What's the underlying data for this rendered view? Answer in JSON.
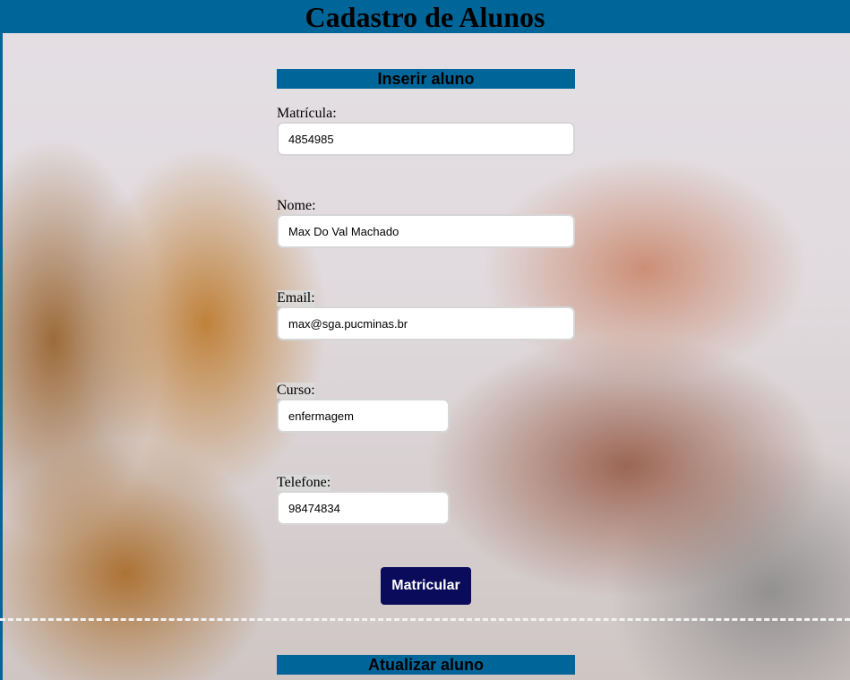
{
  "header": {
    "title": "Cadastro de Alunos"
  },
  "insert_section": {
    "heading": "Inserir aluno",
    "fields": {
      "matricula": {
        "label": "Matrícula:",
        "value": "4854985"
      },
      "nome": {
        "label": "Nome:",
        "value": "Max Do Val Machado"
      },
      "email": {
        "label": "Email:",
        "value": "max@sga.pucminas.br"
      },
      "curso": {
        "label": "Curso:",
        "value": "enfermagem"
      },
      "telefone": {
        "label": "Telefone:",
        "value": "98474834"
      }
    },
    "submit_label": "Matricular"
  },
  "update_section": {
    "heading": "Atualizar aluno"
  },
  "colors": {
    "header_band": "#006699",
    "button": "#0b0b5c"
  }
}
